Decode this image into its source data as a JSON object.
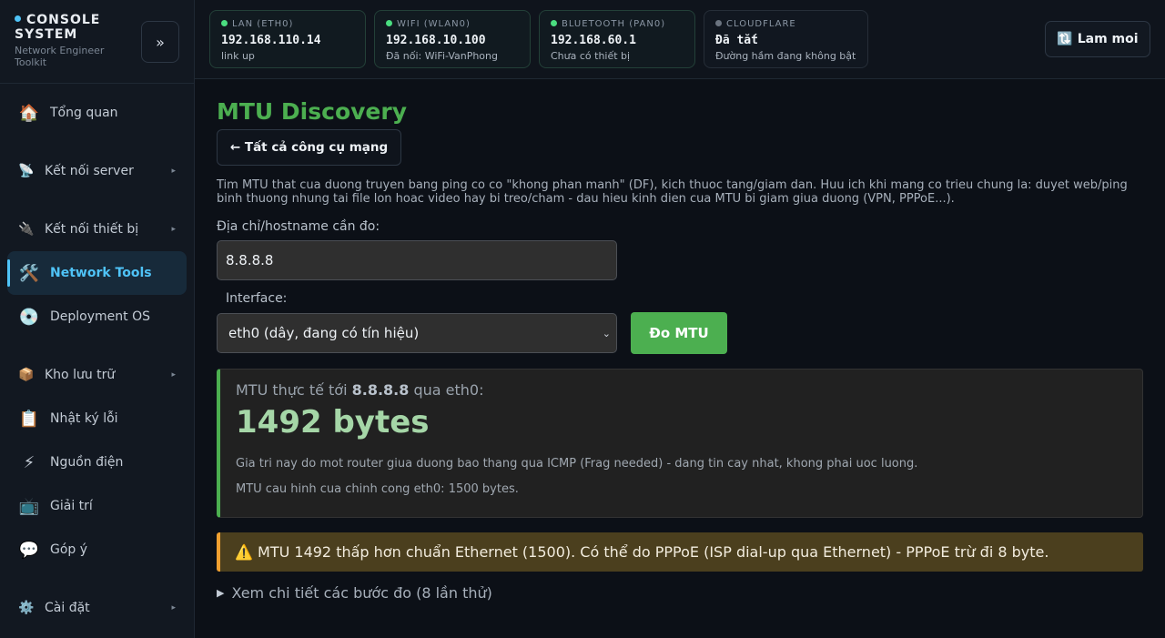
{
  "brand": {
    "title": "CONSOLE SYSTEM",
    "subtitle": "Network Engineer Toolkit",
    "collapse_label": "»"
  },
  "nav": [
    {
      "label": "Tổng quan",
      "icon": "🏠",
      "icon_name": "home-icon"
    },
    {
      "label": "Kết nối server",
      "icon": "📡",
      "icon_name": "satellite-icon",
      "caret": "▸"
    },
    {
      "label": "Kết nối thiết bị",
      "icon": "🔌",
      "icon_name": "plug-icon",
      "caret": "▸"
    },
    {
      "label": "Network Tools",
      "icon": "🛠️",
      "icon_name": "tools-icon"
    },
    {
      "label": "Deployment OS",
      "icon": "💿",
      "icon_name": "disc-icon"
    },
    {
      "label": "Kho lưu trữ",
      "icon": "📦",
      "icon_name": "package-icon",
      "caret": "▸"
    },
    {
      "label": "Nhật ký lỗi",
      "icon": "📋",
      "icon_name": "clipboard-icon"
    },
    {
      "label": "Nguồn điện",
      "icon": "⚡",
      "icon_name": "lightning-icon"
    },
    {
      "label": "Giải trí",
      "icon": "📺",
      "icon_name": "tv-icon"
    },
    {
      "label": "Góp ý",
      "icon": "💬",
      "icon_name": "chat-icon"
    },
    {
      "label": "Cài đặt",
      "icon": "⚙️",
      "icon_name": "gear-icon",
      "caret": "▸"
    }
  ],
  "interfaces": [
    {
      "label": "LAN (ETH0)",
      "ip": "192.168.110.14",
      "status": "link up",
      "state_color": "#4ade80"
    },
    {
      "label": "WIFI (WLAN0)",
      "ip": "192.168.10.100",
      "status": "Đã nối: WiFi-VanPhong",
      "state_color": "#4ade80"
    },
    {
      "label": "BLUETOOTH (PAN0)",
      "ip": "192.168.60.1",
      "status": "Chưa có thiết bị",
      "state_color": "#4ade80"
    },
    {
      "label": "CLOUDFLARE",
      "ip": "Đã tắt",
      "status": "Đường hầm đang không bật",
      "state_color": "#6b7480"
    }
  ],
  "topbar": {
    "refresh_label": "🔃 Lam moi"
  },
  "page": {
    "title": "MTU Discovery",
    "back_label": "← Tất cả công cụ mạng",
    "description": "Tim MTU that cua duong truyen bang ping co co \"khong phan manh\" (DF), kich thuoc tang/giam dan. Huu ich khi mang co trieu chung la: duyet web/ping binh thuong nhung tai file lon hoac video hay bi treo/cham - dau hieu kinh dien cua MTU bi giam giua duong (VPN, PPPoE...).",
    "host_label": "Địa chỉ/hostname cần đo:",
    "host_value": "8.8.8.8",
    "iface_label": "Interface:",
    "iface_value": "eth0 (dây, đang có tín hiệu)",
    "run_label": "Đo MTU"
  },
  "result": {
    "prefix": "MTU thực tế tới ",
    "target": "8.8.8.8",
    "suffix": " qua eth0:",
    "value": "1492 bytes",
    "note": "Gia tri nay do mot router giua duong bao thang qua ICMP (Frag needed) - dang tin cay nhat, khong phai uoc luong.",
    "config_note": "MTU cau hinh cua chinh cong eth0: 1500 bytes."
  },
  "warning": {
    "icon": "⚠️",
    "text": "MTU 1492 thấp hơn chuẩn Ethernet (1500). Có thể do PPPoE (ISP dial-up qua Ethernet) - PPPoE trừ đi 8 byte."
  },
  "details": {
    "label": "Xem chi tiết các bước đo (8 lần thử)"
  },
  "colors": {
    "accent": "#4fc3f7",
    "success": "#4caf50",
    "warning": "#f0a030"
  }
}
